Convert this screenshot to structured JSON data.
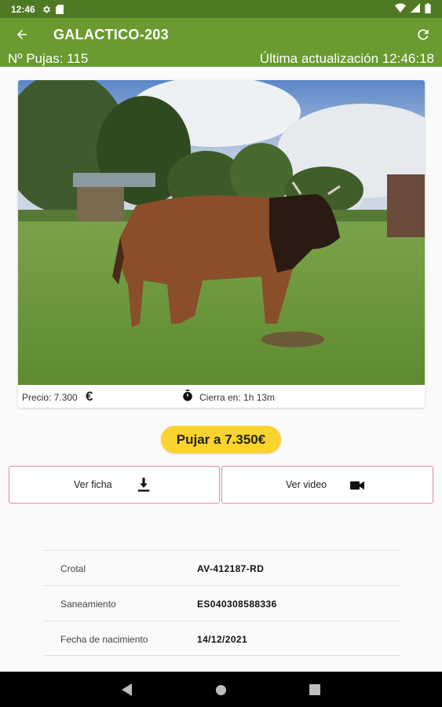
{
  "status_bar": {
    "time": "12:46"
  },
  "app_bar": {
    "title": "GALACTICO-203",
    "pujas": "Nº Pujas: 115",
    "last_update": "Última actualización 12:46:18"
  },
  "card": {
    "precio": "Precio: 7.300",
    "currency_symbol": "€",
    "cierra": "Cierra en: 1h 13m"
  },
  "actions": {
    "bid_label": "Pujar a 7.350€",
    "ver_ficha": "Ver ficha",
    "ver_video": "Ver video"
  },
  "details": [
    {
      "label": "Crotal",
      "value": "AV-412187-RD"
    },
    {
      "label": "Saneamiento",
      "value": "ES040308588336"
    },
    {
      "label": "Fecha de nacimiento",
      "value": "14/12/2021"
    }
  ],
  "colors": {
    "status_bar": "#4f7a23",
    "app_bar": "#6a9a30",
    "bid_button": "#fbd32e",
    "outline_button_border": "#e08a9a"
  },
  "icons": [
    "settings-icon",
    "sd-card-icon",
    "wifi-icon",
    "signal-icon",
    "battery-icon",
    "back-arrow-icon",
    "refresh-icon",
    "euro-icon",
    "stopwatch-icon",
    "download-icon",
    "videocam-icon",
    "nav-back-icon",
    "nav-home-icon",
    "nav-recents-icon"
  ]
}
